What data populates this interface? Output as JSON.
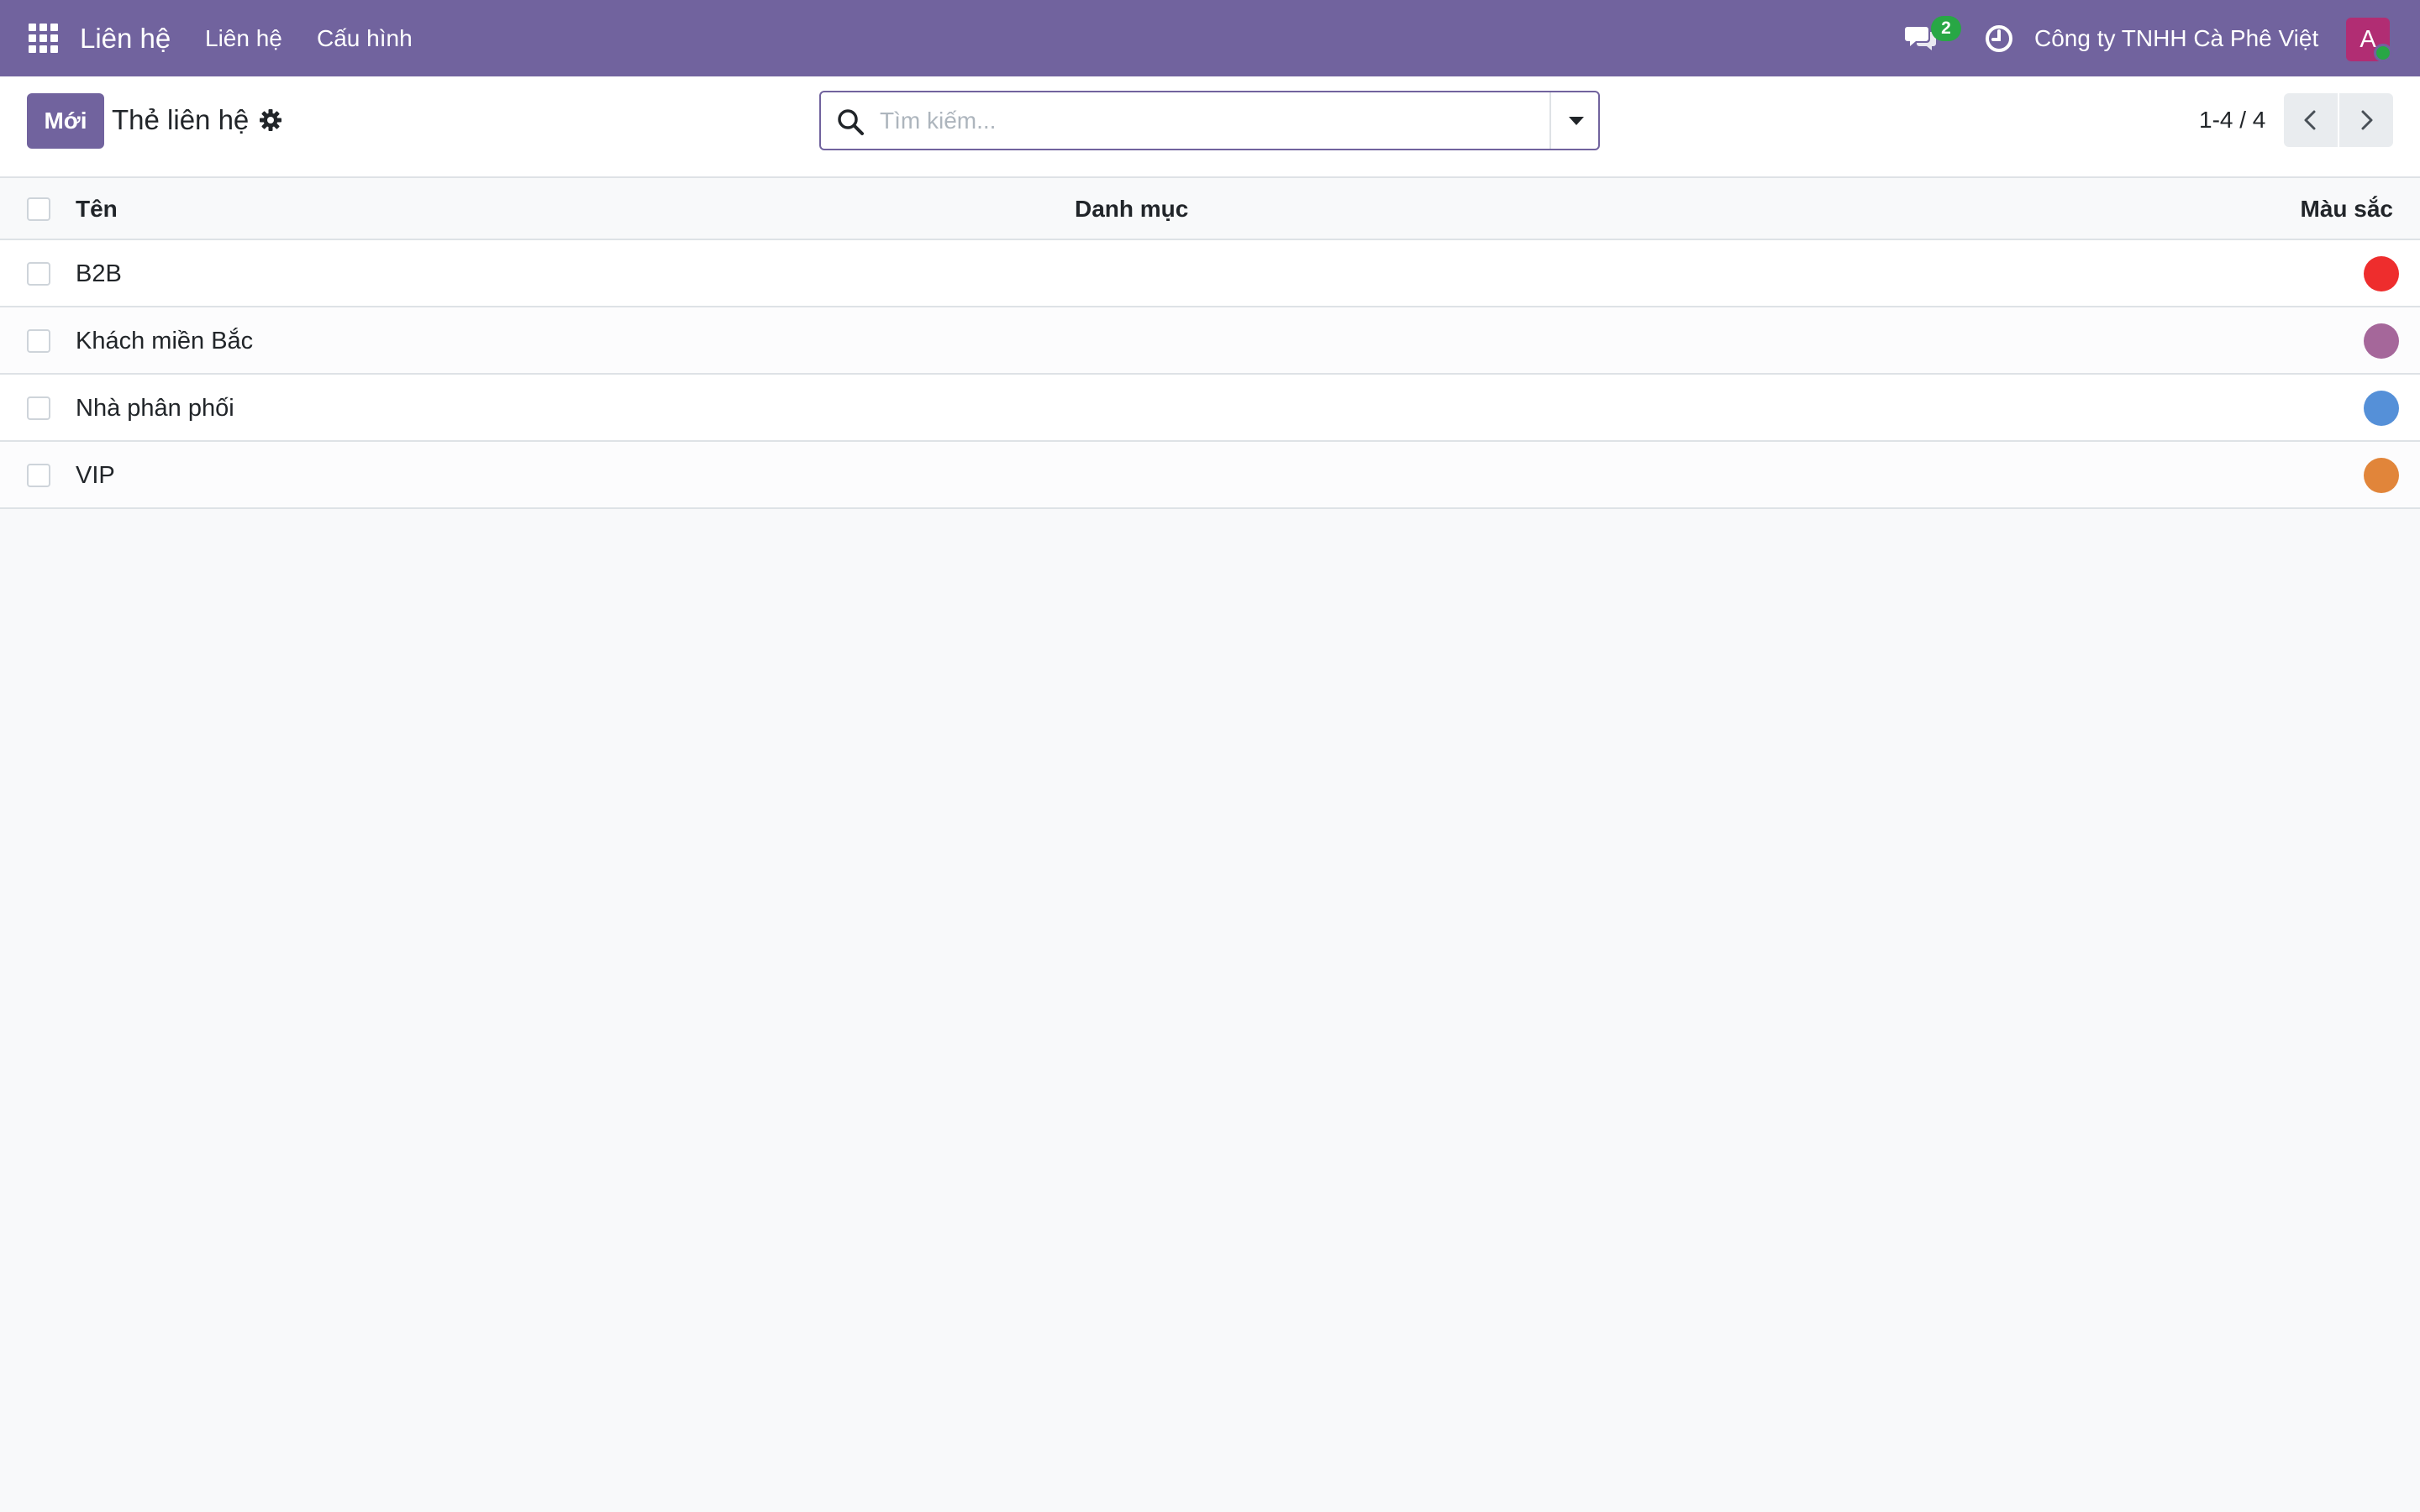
{
  "navbar": {
    "brand": "Liên hệ",
    "menus": [
      "Liên hệ",
      "Cấu hình"
    ],
    "chat_count": "2",
    "company": "Công ty TNHH Cà Phê Việt",
    "avatar_letter": "A"
  },
  "control_panel": {
    "new_button": "Mới",
    "title": "Thẻ liên hệ",
    "search_placeholder": "Tìm kiếm...",
    "pager": "1-4 / 4"
  },
  "list": {
    "columns": [
      "Tên",
      "Danh mục",
      "Màu sắc"
    ],
    "rows": [
      {
        "name": "B2B",
        "color": "#ee2d2d"
      },
      {
        "name": "Khách miền Bắc",
        "color": "#a5679a"
      },
      {
        "name": "Nhà phân phối",
        "color": "#5590d8"
      },
      {
        "name": "VIP",
        "color": "#e1853a"
      }
    ]
  },
  "icons": {
    "apps": "apps-grid-icon",
    "chat": "chat-icon",
    "clock": "clock-icon",
    "gear": "gear-icon",
    "search": "search-icon",
    "dropdown": "caret-down-icon",
    "prev": "chevron-left-icon",
    "next": "chevron-right-icon"
  }
}
